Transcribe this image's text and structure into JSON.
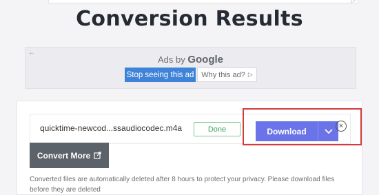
{
  "page": {
    "title": "Conversion Results"
  },
  "ad": {
    "back_icon": "back-arrow-icon",
    "ads_by": "Ads by",
    "google": "Google",
    "stop_label": "Stop seeing this ad",
    "why_label": "Why this ad?",
    "why_icon": "play-icon"
  },
  "result": {
    "file_name": "quicktime-newcod...ssaudiocodec.m4a",
    "status": "Done",
    "download_label": "Download",
    "dropdown_icon": "chevron-down-icon",
    "remove_icon": "close-circle-icon"
  },
  "convert_more": {
    "label": "Convert More",
    "icon": "external-link-icon"
  },
  "notice": "Converted files are automatically deleted after 8 hours to protect your privacy. Please download files before they are deleted",
  "colors": {
    "download": "#6b73e8",
    "done": "#3fa45f",
    "highlight": "#d43a3a",
    "stop_ad": "#3f83d8"
  }
}
